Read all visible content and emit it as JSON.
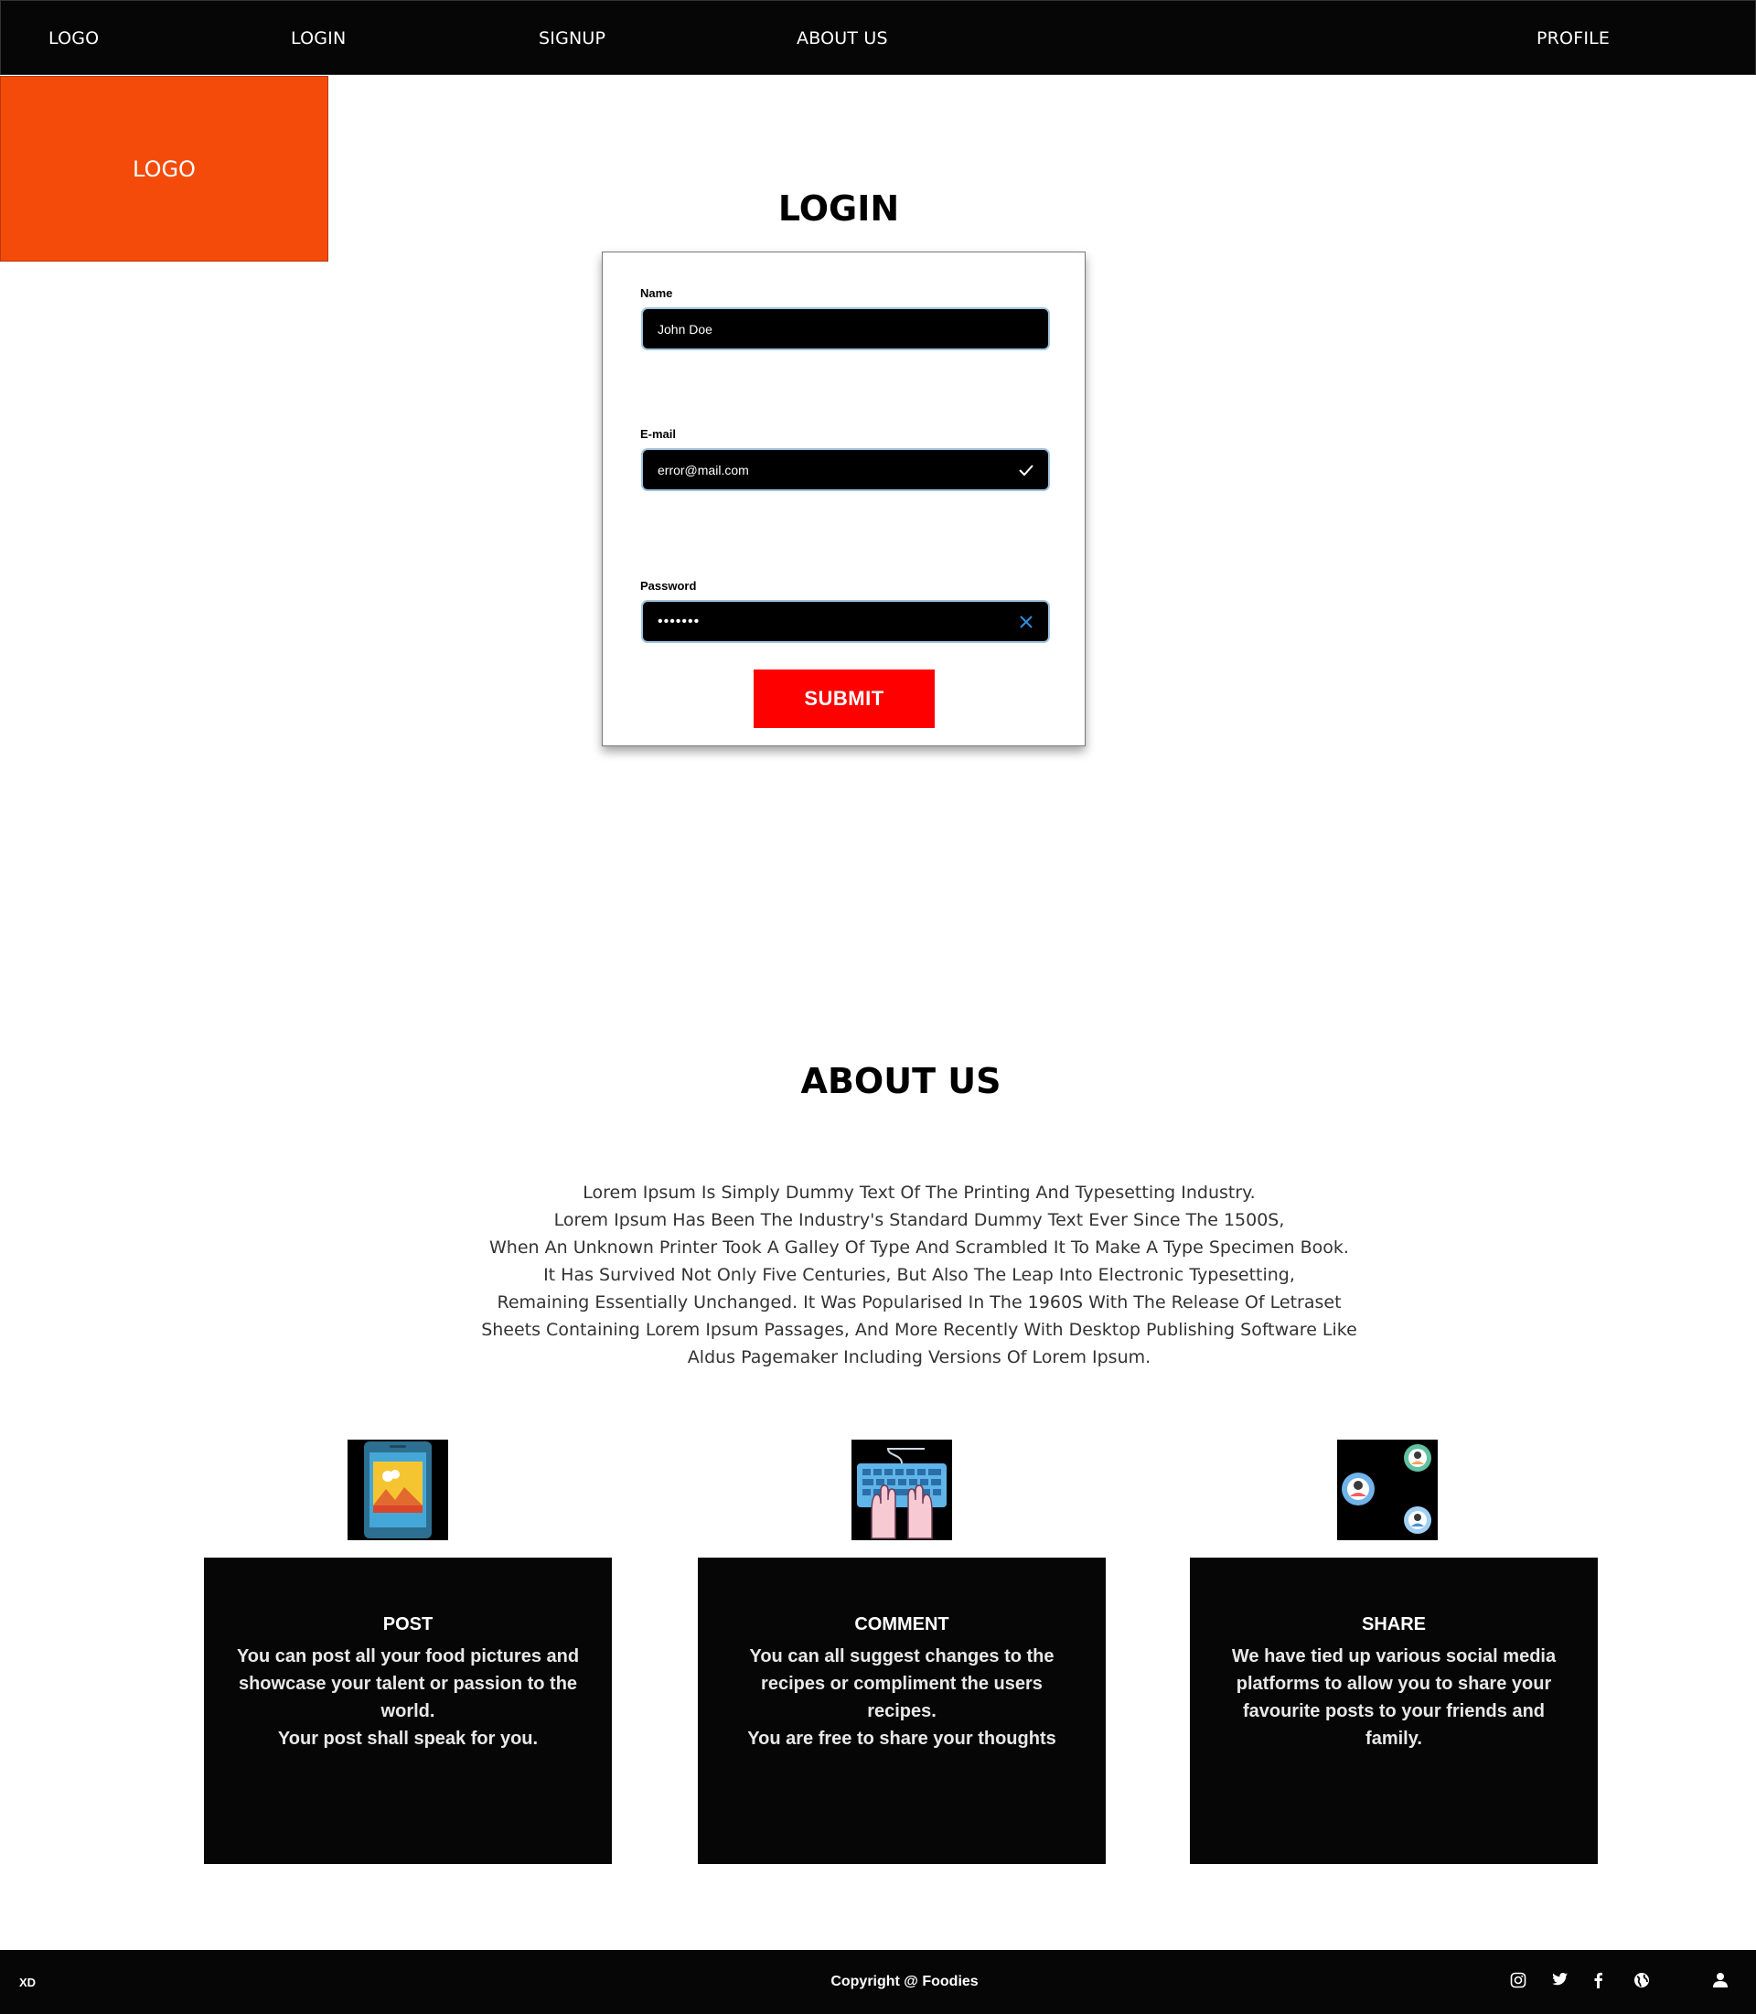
{
  "nav": {
    "logo": "LOGO",
    "login": "LOGIN",
    "signup": "SIGNUP",
    "about": "ABOUT US",
    "profile": "PROFILE"
  },
  "logo_block": {
    "label": "LOGO",
    "color": "#f44b0b"
  },
  "login": {
    "title": "LOGIN",
    "name_label": "Name",
    "name_value": "John Doe",
    "email_label": "E-mail",
    "email_value": "error@mail.com",
    "email_state_icon": "checkmark-icon",
    "password_label": "Password",
    "password_value": "•••••••",
    "password_state_icon": "close-icon",
    "submit_label": "SUBMIT",
    "submit_color": "#ff0000"
  },
  "about": {
    "title": "ABOUT US",
    "lines": [
      "Lorem Ipsum Is Simply Dummy Text Of The Printing And Typesetting Industry.",
      "Lorem Ipsum Has Been The Industry's Standard Dummy Text Ever Since The 1500S,",
      "When An Unknown Printer Took A Galley Of Type And Scrambled It To Make A Type Specimen Book.",
      "It Has Survived Not Only Five Centuries, But Also The Leap Into Electronic Typesetting,",
      "Remaining Essentially Unchanged. It Was Popularised In The 1960S With The Release Of Letraset",
      "Sheets Containing Lorem Ipsum Passages, And More Recently With Desktop Publishing Software Like",
      "Aldus Pagemaker Including Versions Of Lorem Ipsum."
    ]
  },
  "features": [
    {
      "icon": "tablet-image-icon",
      "title": "POST",
      "lines": [
        "You can post all your food pictures and",
        "showcase your talent or passion to the",
        "world.",
        "Your post shall speak for you."
      ]
    },
    {
      "icon": "keyboard-hands-icon",
      "title": "COMMENT",
      "lines": [
        "You can all suggest changes to the",
        "recipes or compliment the users",
        "recipes.",
        "You are free to share your thoughts"
      ]
    },
    {
      "icon": "users-network-icon",
      "title": "SHARE",
      "lines": [
        "We have tied up various social media",
        "platforms to allow you to share your",
        "favourite posts to your friends and",
        "family."
      ]
    }
  ],
  "footer": {
    "left": "XD",
    "copyright": "Copyright @ Foodies",
    "icons": [
      "instagram-icon",
      "twitter-icon",
      "facebook-icon",
      "globe-icon",
      "user-icon"
    ]
  }
}
